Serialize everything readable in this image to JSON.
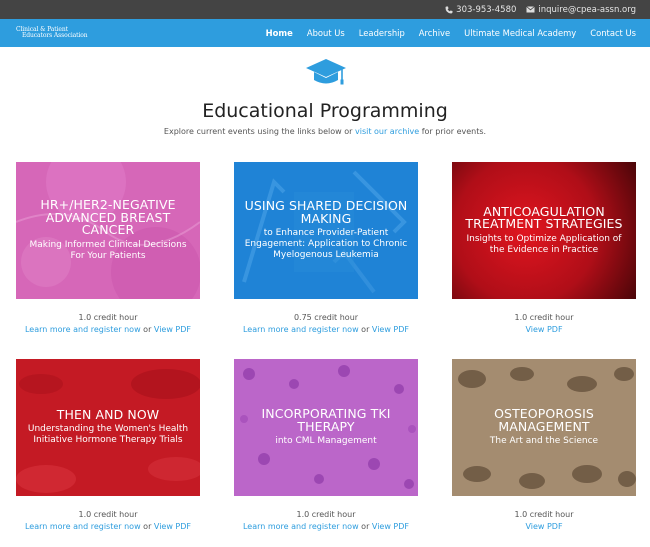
{
  "topbar": {
    "phone": "303-953-4580",
    "email": "inquire@cpea-assn.org"
  },
  "logo": {
    "line1": "Clinical & Patient",
    "line2": "Educators Association"
  },
  "nav": [
    "Home",
    "About Us",
    "Leadership",
    "Archive",
    "Ultimate Medical Academy",
    "Contact Us"
  ],
  "page": {
    "title": "Educational Programming",
    "sub_before": "Explore current events using the links below or ",
    "sub_link": "visit our archive",
    "sub_after": " for prior events."
  },
  "colors": {
    "brand": "#2e9dde",
    "topbar": "#444444"
  },
  "cards": [
    {
      "title": "HR+/HER2-Negative Advanced Breast Cancer",
      "subtitle": "Making Informed Clinical Decisions For Your Patients",
      "credit": "1.0 credit hour",
      "learn": "Learn more and register now",
      "or": "or",
      "pdf": "View PDF",
      "color": "#d463b5"
    },
    {
      "title": "Using Shared Decision Making",
      "subtitle": "to Enhance Provider-Patient Engagement: Application to Chronic Myelogenous Leukemia",
      "credit": "0.75 credit hour",
      "learn": "Learn more and register now",
      "or": "or",
      "pdf": "View PDF",
      "color": "#1f83d6"
    },
    {
      "title": "Anticoagulation Treatment Strategies",
      "subtitle": "Insights to Optimize Application of the Evidence in Practice",
      "credit": "1.0 credit hour",
      "learn": "",
      "or": "",
      "pdf": "View PDF",
      "color": "#c0121e"
    },
    {
      "title": "Then and Now",
      "subtitle": "Understanding the Women's Health Initiative Hormone Therapy Trials",
      "credit": "1.0 credit hour",
      "learn": "Learn more and register now",
      "or": "or",
      "pdf": "View PDF",
      "color": "#c41a24"
    },
    {
      "title": "Incorporating TKI Therapy",
      "subtitle": "into CML Management",
      "credit": "1.0 credit hour",
      "learn": "Learn more and register now",
      "or": "or",
      "pdf": "View PDF",
      "color": "#b964c8"
    },
    {
      "title": "Osteoporosis Management",
      "subtitle": "The Art and the Science",
      "credit": "1.0 credit hour",
      "learn": "",
      "or": "",
      "pdf": "View PDF",
      "color": "#a38b6e"
    }
  ]
}
